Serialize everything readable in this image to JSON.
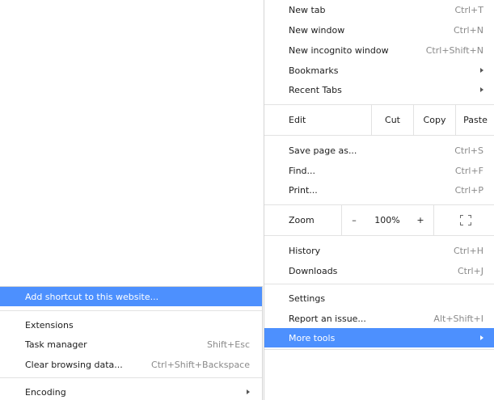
{
  "main_menu": {
    "new_tab": {
      "label": "New tab",
      "shortcut": "Ctrl+T"
    },
    "new_window": {
      "label": "New window",
      "shortcut": "Ctrl+N"
    },
    "new_incognito": {
      "label": "New incognito window",
      "shortcut": "Ctrl+Shift+N"
    },
    "bookmarks": {
      "label": "Bookmarks"
    },
    "recent_tabs": {
      "label": "Recent Tabs"
    },
    "edit": {
      "label": "Edit",
      "cut": "Cut",
      "copy": "Copy",
      "paste": "Paste"
    },
    "save_page": {
      "label": "Save page as...",
      "shortcut": "Ctrl+S"
    },
    "find": {
      "label": "Find...",
      "shortcut": "Ctrl+F"
    },
    "print": {
      "label": "Print...",
      "shortcut": "Ctrl+P"
    },
    "zoom": {
      "label": "Zoom",
      "minus": "–",
      "value": "100%",
      "plus": "+"
    },
    "history": {
      "label": "History",
      "shortcut": "Ctrl+H"
    },
    "downloads": {
      "label": "Downloads",
      "shortcut": "Ctrl+J"
    },
    "settings": {
      "label": "Settings"
    },
    "report_issue": {
      "label": "Report an issue...",
      "shortcut": "Alt+Shift+I"
    },
    "more_tools": {
      "label": "More tools"
    }
  },
  "more_tools_menu": {
    "add_shortcut": {
      "label": "Add shortcut to this website..."
    },
    "extensions": {
      "label": "Extensions"
    },
    "task_manager": {
      "label": "Task manager",
      "shortcut": "Shift+Esc"
    },
    "clear_data": {
      "label": "Clear browsing data...",
      "shortcut": "Ctrl+Shift+Backspace"
    },
    "encoding": {
      "label": "Encoding"
    }
  },
  "colors": {
    "highlight": "#4d90fe",
    "shortcut_text": "#8a8a8a",
    "separator": "#e2e2e2"
  },
  "icons": {
    "submenu_arrow": "chevron-right-icon",
    "fullscreen": "fullscreen-icon"
  }
}
